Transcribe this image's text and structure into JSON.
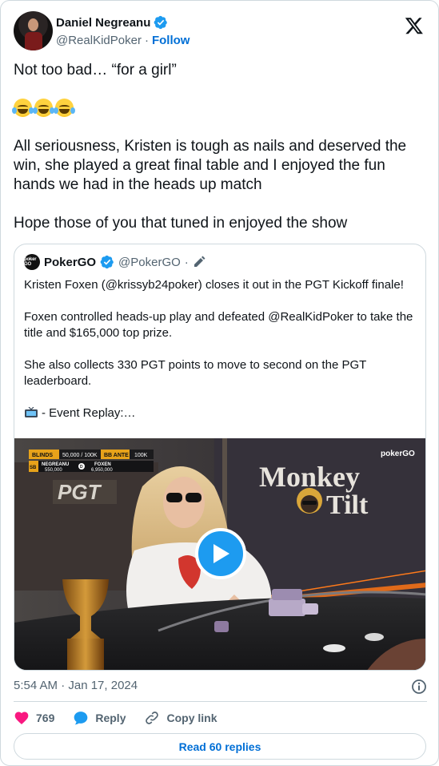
{
  "tweet": {
    "author": {
      "display_name": "Daniel Negreanu",
      "handle": "@RealKidPoker",
      "separator": "·",
      "follow_label": "Follow"
    },
    "text": {
      "line1": "Not too bad… “for a girl”",
      "line2": "All seriousness, Kristen is tough as nails and deserved the win, she played a great final table and I enjoyed the fun hands we had in the heads up match",
      "line3": "Hope those of you that tuned in enjoyed the show"
    },
    "emojis": [
      "face-with-tears-of-joy",
      "face-with-tears-of-joy",
      "face-with-tears-of-joy"
    ],
    "timestamp": "5:54 AM · Jan 17, 2024",
    "actions": {
      "like_count": "769",
      "reply_label": "Reply",
      "copy_link_label": "Copy link"
    },
    "read_replies_label": "Read 60 replies"
  },
  "quote": {
    "avatar_text": "poker GO",
    "display_name": "PokerGO",
    "handle": "@PokerGO",
    "separator": "·",
    "paragraphs": [
      "Kristen Foxen (@krissyb24poker) closes it out in the PGT Kickoff finale!",
      "Foxen controlled heads-up play and defeated @RealKidPoker to take the title and $165,000 top prize.",
      "She also collects 330 PGT points to move to second on the PGT leaderboard."
    ],
    "replay_text": "- Event Replay:…",
    "media": {
      "scoreboard": {
        "blinds_label": "BLINDS",
        "blinds_value": "50,000 / 100K",
        "ante_label": "BB ANTE",
        "ante_value": "100K",
        "player1_seat": "SB",
        "player1_name": "NEGREANU",
        "player1_stack": "550,000",
        "player2_seat": "D",
        "player2_name": "FOXEN",
        "player2_stack": "6,950,000"
      },
      "network_logo": "pokerGO",
      "event_logo": "PGT",
      "sponsor_line1": "Monkey",
      "sponsor_line2": "Tilt"
    }
  },
  "colors": {
    "text": "#0f1419",
    "secondary": "#536471",
    "link": "#006fd6",
    "verified": "#1d9bf0",
    "like": "#f91880",
    "border": "#cfd9de"
  }
}
